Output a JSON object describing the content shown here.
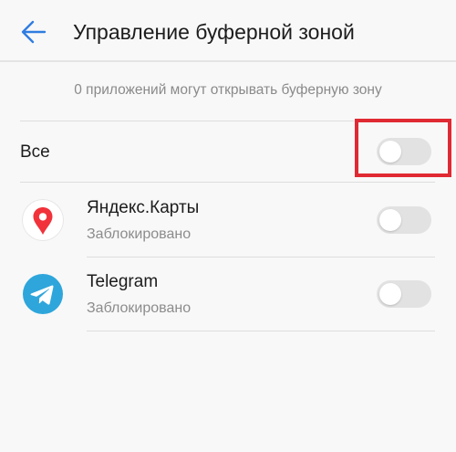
{
  "header": {
    "title": "Управление буферной зоной",
    "back_icon": "arrow-left-icon"
  },
  "info_text": "0 приложений могут открывать буферную зону",
  "all_row": {
    "label": "Все",
    "enabled": false
  },
  "apps": [
    {
      "name": "Яндекс.Карты",
      "status": "Заблокировано",
      "icon": "yandex-maps-icon",
      "enabled": false
    },
    {
      "name": "Telegram",
      "status": "Заблокировано",
      "icon": "telegram-icon",
      "enabled": false
    }
  ],
  "colors": {
    "accent": "#2f7de1",
    "highlight": "#e02a33",
    "toggle_off": "#e2e2e2",
    "telegram": "#2ea6db",
    "yandex_pin": "#f1323a"
  }
}
